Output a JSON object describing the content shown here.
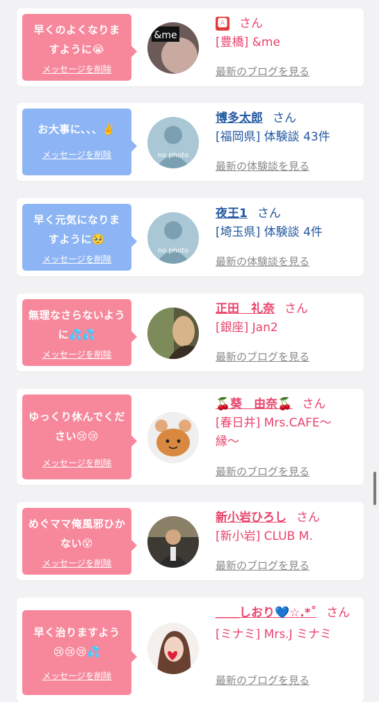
{
  "delete_label": "メッセージを削除",
  "san_label": "さん",
  "items": [
    {
      "bubble_color": "pink",
      "message": "早くのよくなりますように😭",
      "name": "🅰",
      "shop": "[豊橋] &me",
      "latest": "最新のブログを見る",
      "avatar": "andme-photo",
      "avatar_text": "&me"
    },
    {
      "bubble_color": "blue",
      "message": "お大事に、、、✌️",
      "name": "博多太郎",
      "shop": "[福岡県] 体験談 43件",
      "latest": "最新の体験談を見る",
      "avatar": "no-photo",
      "avatar_text": "no photo"
    },
    {
      "bubble_color": "blue",
      "message": "早く元気になりますように🥺",
      "name": "夜王1",
      "shop": "[埼玉県] 体験談 4件",
      "latest": "最新の体験談を見る",
      "avatar": "no-photo",
      "avatar_text": "no photo"
    },
    {
      "bubble_color": "pink",
      "message": "無理なさらないように💦💦",
      "name": "正田　礼奈",
      "shop": "[銀座] Jan2",
      "latest": "最新のブログを見る",
      "avatar": "woman-photo"
    },
    {
      "bubble_color": "pink",
      "message": "ゆっくり休んでください😢😢",
      "name": "🍒葵　由奈🍒",
      "shop": "[春日井] Mrs.CAFE〜縁〜",
      "latest": "最新のブログを見る",
      "avatar": "character-photo"
    },
    {
      "bubble_color": "pink",
      "message": "めぐママ俺風邪ひかない😵",
      "name": "新小岩ひろし",
      "shop": "[新小岩] CLUB M.",
      "latest": "最新のブログを見る",
      "avatar": "man-photo"
    },
    {
      "bubble_color": "pink",
      "message": "早く治りますよう😢😢😢💦",
      "name": "＿＿しおり💙☆.*˚",
      "shop": "[ミナミ] Mrs.J ミナミ",
      "latest": "最新のブログを見る",
      "avatar": "woman-heart-photo"
    }
  ],
  "colors": {
    "pink_bubble": "#f7889c",
    "blue_bubble": "#8db4f4",
    "pink_text": "#e8436b",
    "blue_text": "#2358a0",
    "muted_link": "#888888"
  }
}
